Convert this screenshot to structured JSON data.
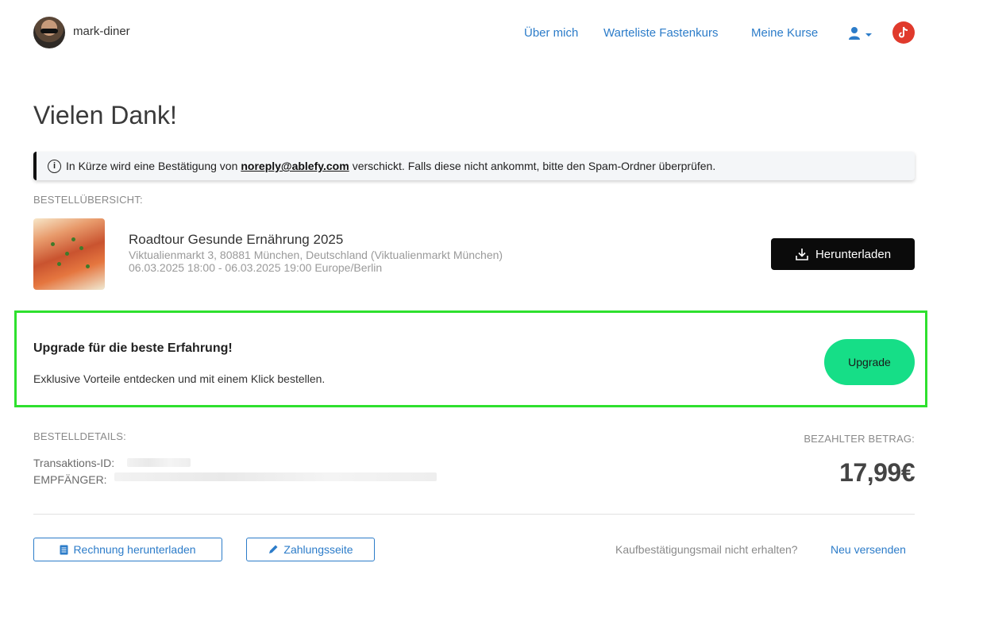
{
  "header": {
    "username": "mark-diner",
    "nav": [
      "Über mich",
      "Warteliste Fastenkurs",
      "Meine Kurse"
    ]
  },
  "page_title": "Vielen Dank!",
  "info_bar": {
    "text_before": "In Kürze wird eine Bestätigung von",
    "email": "noreply@ablefy.com",
    "text_after": "verschickt. Falls diese nicht ankommt, bitte den Spam-Ordner überprüfen."
  },
  "order_overview": {
    "label": "BESTELLÜBERSICHT:",
    "product_title": "Roadtour Gesunde Ernährung 2025",
    "location": "Viktualienmarkt 3, 80881 München, Deutschland (Viktualienmarkt München)",
    "datetime": "06.03.2025 18:00 - 06.03.2025 19:00 Europe/Berlin",
    "download_label": "Herunterladen"
  },
  "upgrade": {
    "title": "Upgrade für die beste Erfahrung!",
    "text": "Exklusive Vorteile entdecken und mit einem Klick bestellen.",
    "button": "Upgrade"
  },
  "details": {
    "label": "BESTELLDETAILS:",
    "transaction_label": "Transaktions-ID:",
    "recipient_label": "EMPFÄNGER:",
    "amount_label": "BEZAHLTER BETRAG:",
    "amount": "17,99€"
  },
  "actions": {
    "invoice": "Rechnung herunterladen",
    "payment_page": "Zahlungsseite",
    "resend_question": "Kaufbestätigungsmail nicht erhalten?",
    "resend_link": "Neu versenden"
  },
  "colors": {
    "link": "#2c7cc9",
    "upgrade_button": "#16de87",
    "highlight_border": "#2ee02e",
    "tiktok": "#e03a2c"
  }
}
